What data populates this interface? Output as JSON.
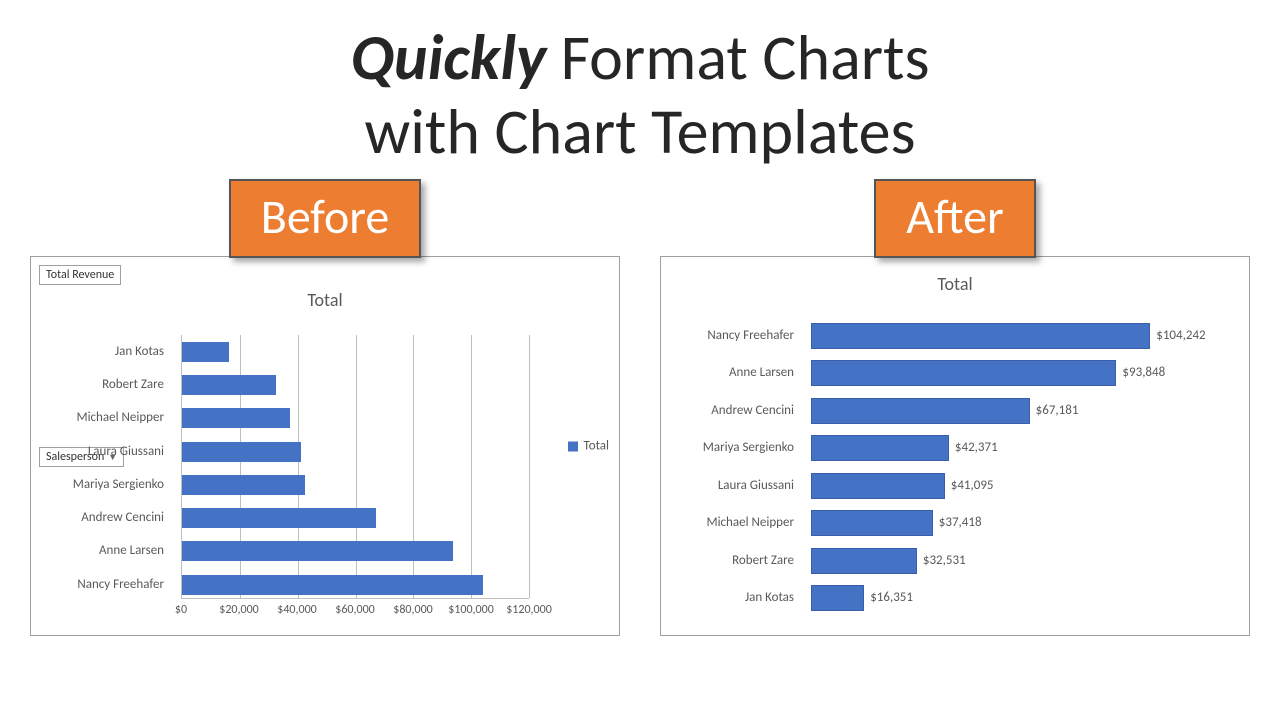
{
  "headline": {
    "emph": "Quickly",
    "rest1": " Format Charts",
    "line2": "with Chart Templates"
  },
  "badges": {
    "before": "Before",
    "after": "After"
  },
  "before": {
    "field_revenue": "Total Revenue",
    "field_salesperson": "Salesperson",
    "chart_title": "Total",
    "legend_label": "Total",
    "xticks": [
      "$0",
      "$20,000",
      "$40,000",
      "$60,000",
      "$80,000",
      "$100,000",
      "$120,000"
    ]
  },
  "after": {
    "chart_title": "Total"
  },
  "chart_data": [
    {
      "id": "before",
      "type": "bar",
      "orientation": "horizontal",
      "title": "Total",
      "xlabel": "",
      "ylabel": "",
      "xlim": [
        0,
        120000
      ],
      "legend": [
        "Total"
      ],
      "categories": [
        "Jan Kotas",
        "Robert Zare",
        "Michael Neipper",
        "Laura Giussani",
        "Mariya Sergienko",
        "Andrew Cencini",
        "Anne Larsen",
        "Nancy Freehafer"
      ],
      "values": [
        16351,
        32531,
        37418,
        41095,
        42371,
        67181,
        93848,
        104242
      ],
      "grid": true
    },
    {
      "id": "after",
      "type": "bar",
      "orientation": "horizontal",
      "title": "Total",
      "xlabel": "",
      "ylabel": "",
      "xlim": [
        0,
        110000
      ],
      "categories": [
        "Nancy Freehafer",
        "Anne Larsen",
        "Andrew Cencini",
        "Mariya Sergienko",
        "Laura Giussani",
        "Michael Neipper",
        "Robert Zare",
        "Jan Kotas"
      ],
      "values": [
        104242,
        93848,
        67181,
        42371,
        41095,
        37418,
        32531,
        16351
      ],
      "data_labels": [
        "$104,242",
        "$93,848",
        "$67,181",
        "$42,371",
        "$41,095",
        "$37,418",
        "$32,531",
        "$16,351"
      ],
      "grid": false
    }
  ]
}
